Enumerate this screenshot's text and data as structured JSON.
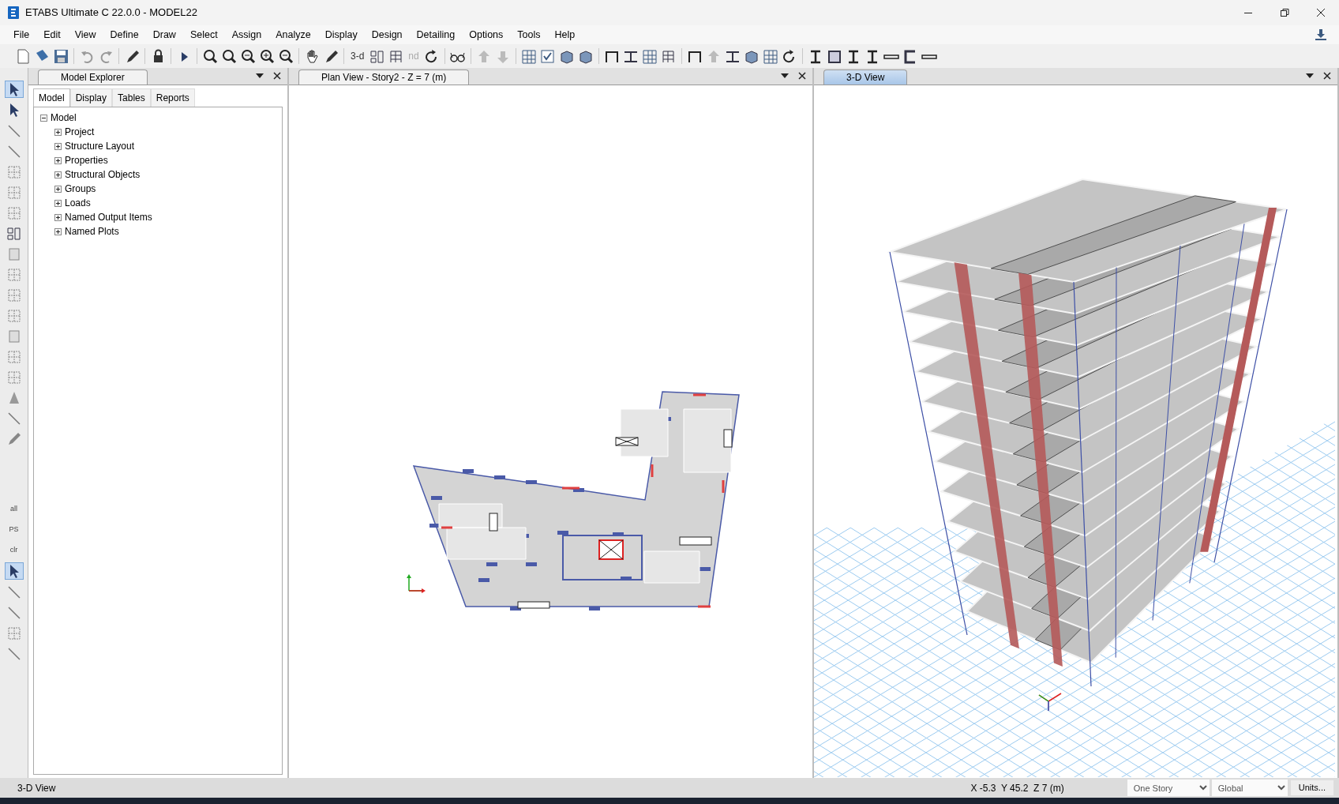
{
  "window": {
    "title": "ETABS Ultimate C 22.0.0 - MODEL22"
  },
  "menu": [
    "File",
    "Edit",
    "View",
    "Define",
    "Draw",
    "Select",
    "Assign",
    "Analyze",
    "Display",
    "Design",
    "Detailing",
    "Options",
    "Tools",
    "Help"
  ],
  "toolbar_texts": [
    {
      "label": "3-d",
      "disabled": false
    },
    {
      "label": "nd",
      "disabled": true
    }
  ],
  "side_toolbar_texts": [
    "all",
    "PS",
    "clr"
  ],
  "explorer": {
    "title": "Model Explorer",
    "tabs": [
      {
        "label": "Model",
        "selected": true
      },
      {
        "label": "Display",
        "selected": false
      },
      {
        "label": "Tables",
        "selected": false
      },
      {
        "label": "Reports",
        "selected": false
      }
    ],
    "tree": {
      "label": "Model",
      "expanded": true,
      "children": [
        {
          "label": "Project",
          "expanded": false
        },
        {
          "label": "Structure Layout",
          "expanded": false
        },
        {
          "label": "Properties",
          "expanded": false
        },
        {
          "label": "Structural Objects",
          "expanded": false
        },
        {
          "label": "Groups",
          "expanded": false
        },
        {
          "label": "Loads",
          "expanded": false
        },
        {
          "label": "Named Output Items",
          "expanded": false
        },
        {
          "label": "Named Plots",
          "expanded": false
        }
      ]
    }
  },
  "views": [
    {
      "title": "Plan View - Story2 - Z = 7 (m)",
      "selected": false,
      "kind": "plan"
    },
    {
      "title": "3-D View",
      "selected": true,
      "kind": "perspective"
    }
  ],
  "status_bar": {
    "view": "3-D View",
    "coordinates": "X -5.3  Y 45.2  Z 7 (m)",
    "story_select": "One Story",
    "system_select": "Global",
    "units_button": "Units..."
  }
}
